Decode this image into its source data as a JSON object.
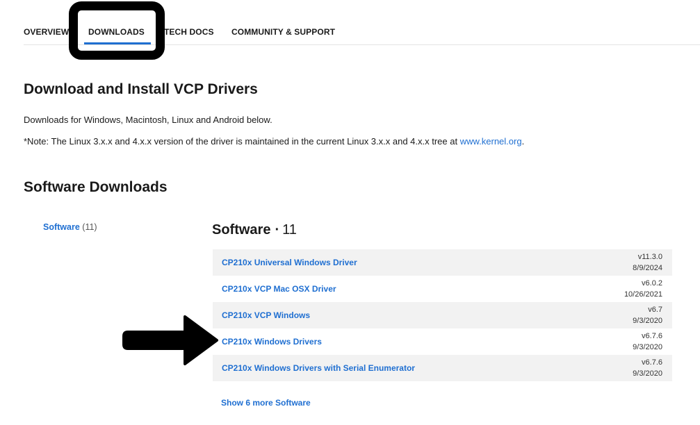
{
  "tabs": [
    {
      "label": "OVERVIEW"
    },
    {
      "label": "DOWNLOADS",
      "active": true
    },
    {
      "label": "TECH DOCS"
    },
    {
      "label": "COMMUNITY & SUPPORT"
    }
  ],
  "intro": {
    "title": "Download and Install VCP Drivers",
    "line1": "Downloads for Windows, Macintosh, Linux and Android below.",
    "note_prefix": "*Note: The Linux 3.x.x and 4.x.x version of the driver is maintained in the current Linux 3.x.x and 4.x.x tree at ",
    "note_link": "www.kernel.org",
    "note_suffix": "."
  },
  "downloads": {
    "title": "Software Downloads",
    "filter": {
      "label": "Software",
      "count": "(11)"
    },
    "section": {
      "title": "Software",
      "separator": "·",
      "count": "11"
    },
    "items": [
      {
        "name": "CP210x Universal Windows Driver",
        "version": "v11.3.0",
        "date": "8/9/2024"
      },
      {
        "name": "CP210x VCP Mac OSX Driver",
        "version": "v6.0.2",
        "date": "10/26/2021"
      },
      {
        "name": "CP210x VCP Windows",
        "version": "v6.7",
        "date": "9/3/2020"
      },
      {
        "name": "CP210x Windows Drivers",
        "version": "v6.7.6",
        "date": "9/3/2020"
      },
      {
        "name": "CP210x Windows Drivers with Serial Enumerator",
        "version": "v6.7.6",
        "date": "9/3/2020"
      }
    ],
    "show_more": "Show 6 more Software"
  },
  "colors": {
    "link": "#1f6fd1",
    "row_alt": "#f2f2f2",
    "annotation": "#000000"
  },
  "annotations": {
    "highlight_box_target": "tab-downloads",
    "arrow_target": "CP210x Windows Drivers"
  }
}
